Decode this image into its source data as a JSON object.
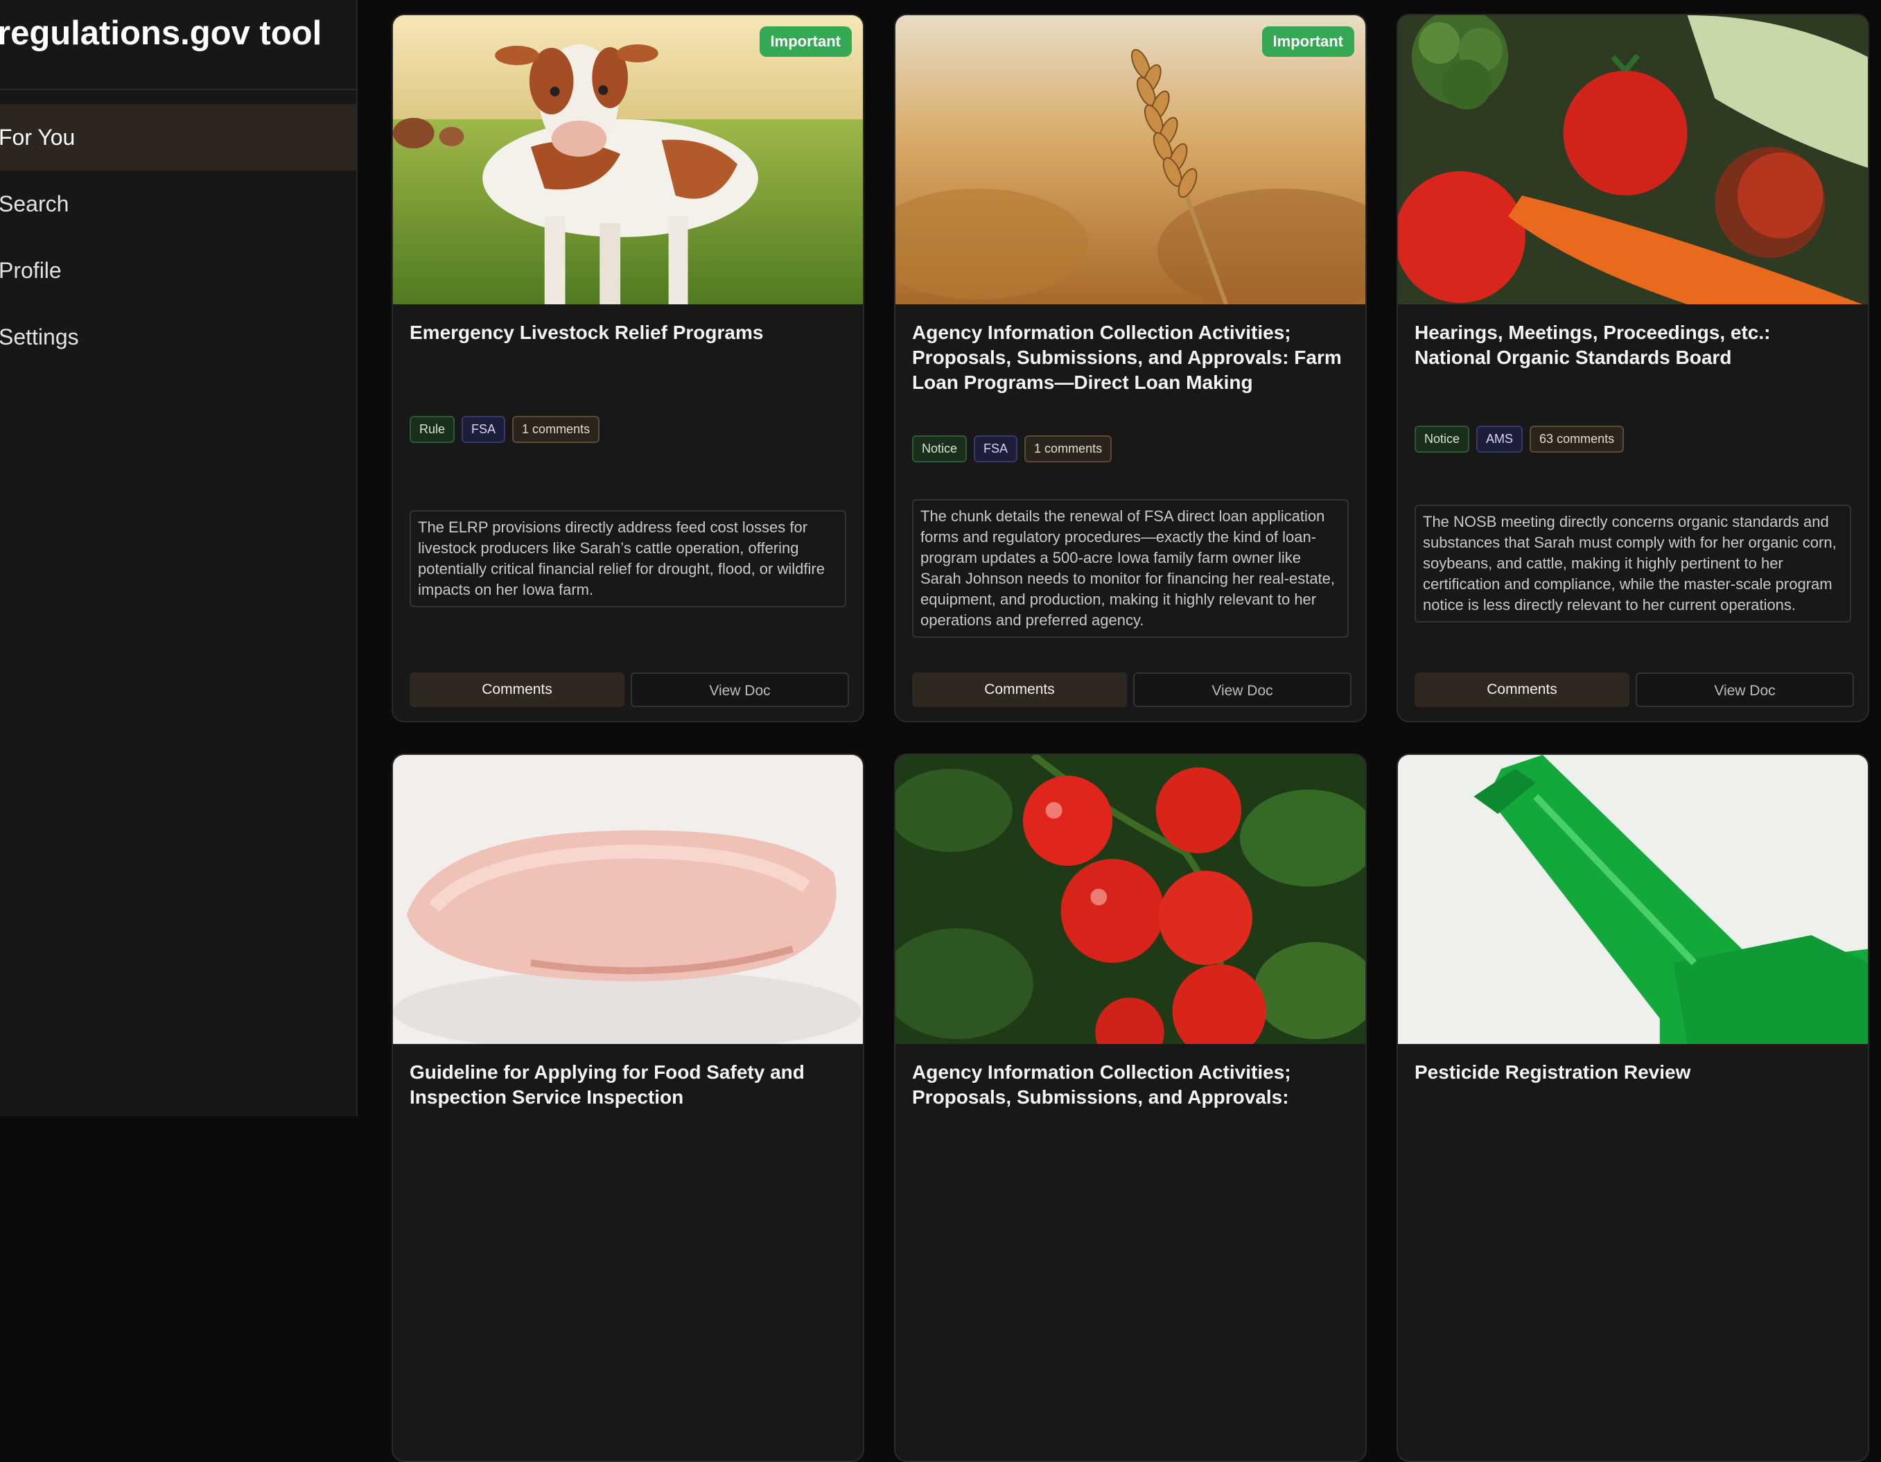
{
  "app": {
    "title": "regulations.gov tool"
  },
  "nav": {
    "items": [
      {
        "label": "For You",
        "active": true
      },
      {
        "label": "Search"
      },
      {
        "label": "Profile"
      },
      {
        "label": "Settings"
      }
    ]
  },
  "cards": [
    {
      "important_label": "Important",
      "title": "Emergency Livestock Relief Programs",
      "type": "Rule",
      "agency": "FSA",
      "comments": "1 comments",
      "summary": "The ELRP provisions directly address feed cost losses for livestock producers like Sarah’s cattle operation, offering potentially critical financial relief for drought, flood, or wildfire impacts on her Iowa farm.",
      "comments_button": "Comments",
      "view_button": "View Doc"
    },
    {
      "important_label": "Important",
      "title": "Agency Information Collection Activities; Proposals, Submissions, and Approvals: Farm Loan Programs—Direct Loan Making",
      "type": "Notice",
      "agency": "FSA",
      "comments": "1 comments",
      "summary": "The chunk details the renewal of FSA direct loan application forms and regulatory procedures—exactly the kind of loan-program updates a 500-acre Iowa family farm owner like Sarah Johnson needs to monitor for financing her real-estate, equipment, and production, making it highly relevant to her operations and preferred agency.",
      "comments_button": "Comments",
      "view_button": "View Doc"
    },
    {
      "title": "Hearings, Meetings, Proceedings, etc.: National Organic Standards Board",
      "type": "Notice",
      "agency": "AMS",
      "comments": "63 comments",
      "summary": "The NOSB meeting directly concerns organic standards and substances that Sarah must comply with for her organic corn, soybeans, and cattle, making it highly pertinent to her certification and compliance, while the master-scale program notice is less directly relevant to her current operations.",
      "comments_button": "Comments",
      "view_button": "View Doc"
    },
    {
      "title": "Guideline for Applying for Food Safety and Inspection Service Inspection"
    },
    {
      "title": "Agency Information Collection Activities; Proposals, Submissions, and Approvals:"
    },
    {
      "title": "Pesticide Registration Review"
    }
  ]
}
